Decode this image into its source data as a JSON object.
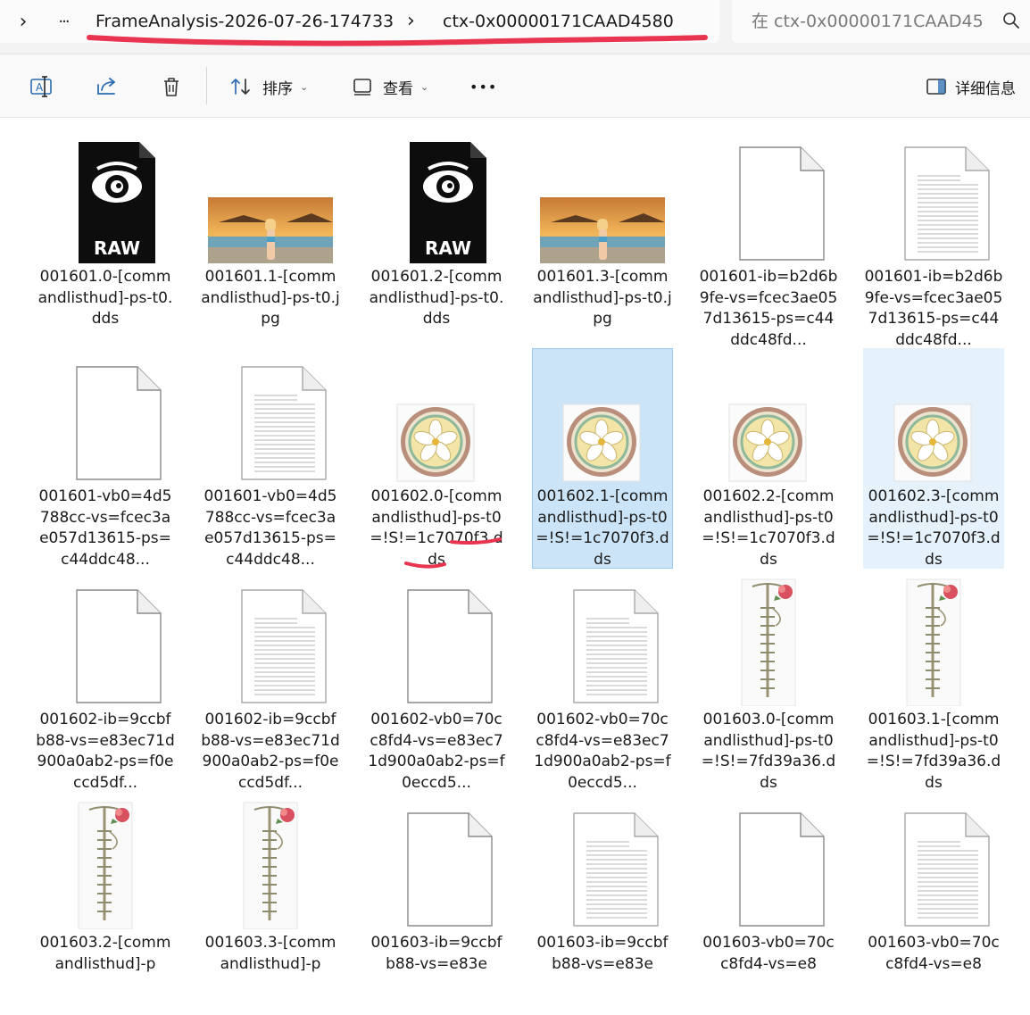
{
  "breadcrumb": {
    "expand_glyph": "›",
    "more_glyph": "···",
    "folder": "FrameAnalysis-2026-07-26-174733",
    "separator": "›",
    "current": "ctx-0x00000171CAAD4580"
  },
  "search": {
    "placeholder": "在 ctx-0x00000171CAAD45"
  },
  "toolbar": {
    "sort_label": "排序",
    "view_label": "查看",
    "details_label": "详细信息",
    "more_glyph": "•••"
  },
  "annotation_color": "#e8344e",
  "files": [
    {
      "name": "001601.0-[commandlisthud]-ps-t0.dds",
      "icon": "raw-icon"
    },
    {
      "name": "001601.1-[commandlisthud]-ps-t0.jpg",
      "icon": "photo-thumbnail"
    },
    {
      "name": "001601.2-[commandlisthud]-ps-t0.dds",
      "icon": "raw-icon"
    },
    {
      "name": "001601.3-[commandlisthud]-ps-t0.jpg",
      "icon": "photo-thumbnail"
    },
    {
      "name": "001601-ib=b2d6b9fe-vs=fcec3ae057d13615-ps=c44ddc48fd...",
      "icon": "blank-file-icon"
    },
    {
      "name": "001601-ib=b2d6b9fe-vs=fcec3ae057d13615-ps=c44ddc48fd...",
      "icon": "text-file-icon"
    },
    {
      "name": "001601-vb0=4d5788cc-vs=fcec3ae057d13615-ps=c44ddc48...",
      "icon": "blank-file-icon"
    },
    {
      "name": "001601-vb0=4d5788cc-vs=fcec3ae057d13615-ps=c44ddc48...",
      "icon": "text-file-icon"
    },
    {
      "name": "001602.0-[commandlisthud]-ps-t0=!S!=1c7070f3.dds",
      "icon": "flower-badge-thumbnail"
    },
    {
      "name": "001602.1-[commandlisthud]-ps-t0=!S!=1c7070f3.dds",
      "icon": "flower-badge-thumbnail"
    },
    {
      "name": "001602.2-[commandlisthud]-ps-t0=!S!=1c7070f3.dds",
      "icon": "flower-badge-thumbnail"
    },
    {
      "name": "001602.3-[commandlisthud]-ps-t0=!S!=1c7070f3.dds",
      "icon": "flower-badge-thumbnail"
    },
    {
      "name": "001602-ib=9ccbfb88-vs=e83ec71d900a0ab2-ps=f0eccd5df...",
      "icon": "blank-file-icon"
    },
    {
      "name": "001602-ib=9ccbfb88-vs=e83ec71d900a0ab2-ps=f0eccd5df...",
      "icon": "text-file-icon"
    },
    {
      "name": "001602-vb0=70cc8fd4-vs=e83ec71d900a0ab2-ps=f0eccd5...",
      "icon": "blank-file-icon"
    },
    {
      "name": "001602-vb0=70cc8fd4-vs=e83ec71d900a0ab2-ps=f0eccd5...",
      "icon": "text-file-icon"
    },
    {
      "name": "001603.0-[commandlisthud]-ps-t0=!S!=7fd39a36.dds",
      "icon": "vine-ladder-thumbnail"
    },
    {
      "name": "001603.1-[commandlisthud]-ps-t0=!S!=7fd39a36.dds",
      "icon": "vine-ladder-thumbnail"
    },
    {
      "name": "001603.2-[commandlisthud]-p",
      "icon": "vine-ladder-thumbnail"
    },
    {
      "name": "001603.3-[commandlisthud]-p",
      "icon": "vine-ladder-thumbnail"
    },
    {
      "name": "001603-ib=9ccbfb88-vs=e83e",
      "icon": "blank-file-icon"
    },
    {
      "name": "001603-ib=9ccbfb88-vs=e83e",
      "icon": "text-file-icon"
    },
    {
      "name": "001603-vb0=70cc8fd4-vs=e8",
      "icon": "blank-file-icon"
    },
    {
      "name": "001603-vb0=70cc8fd4-vs=e8",
      "icon": "text-file-icon"
    }
  ],
  "selection": {
    "selected_index": 9,
    "hover_index": 11
  }
}
